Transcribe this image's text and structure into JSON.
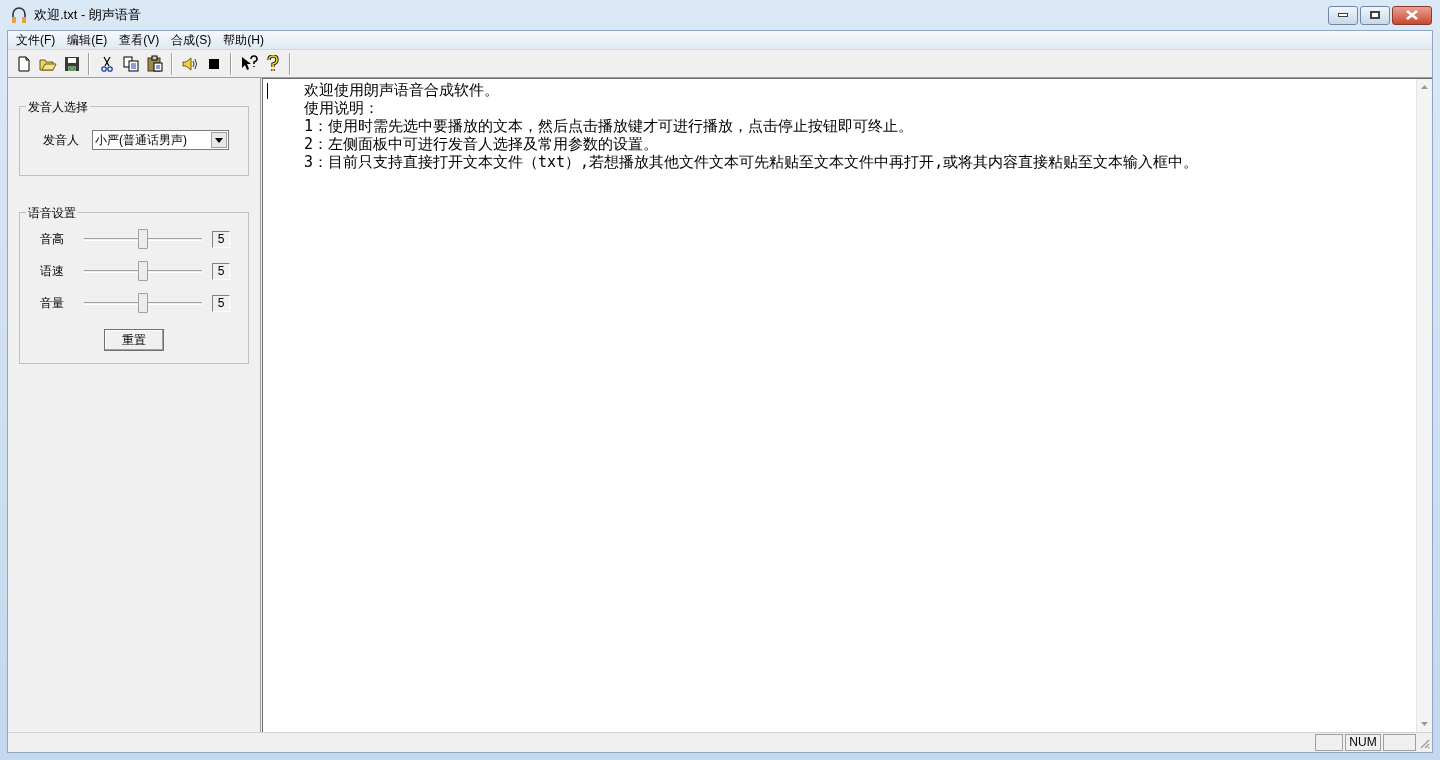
{
  "window": {
    "title": "欢迎.txt - 朗声语音"
  },
  "menu": [
    "文件(F)",
    "编辑(E)",
    "查看(V)",
    "合成(S)",
    "帮助(H)"
  ],
  "speaker_group": {
    "title": "发音人选择",
    "label": "发音人",
    "value": "小严(普通话男声)"
  },
  "voice_group": {
    "title": "语音设置",
    "sliders": [
      {
        "label": "音高",
        "level": 0.5,
        "value": "5"
      },
      {
        "label": "语速",
        "level": 0.5,
        "value": "5"
      },
      {
        "label": "音量",
        "level": 0.5,
        "value": "5"
      }
    ],
    "button": "重置"
  },
  "editor": {
    "lines": [
      "欢迎使用朗声语音合成软件。",
      "使用说明：",
      "1：使用时需先选中要播放的文本，然后点击播放键才可进行播放，点击停止按钮即可终止。",
      "2：左侧面板中可进行发音人选择及常用参数的设置。",
      "3：目前只支持直接打开文本文件（txt）,若想播放其他文件文本可先粘贴至文本文件中再打开,或将其内容直接粘贴至文本输入框中。"
    ]
  },
  "status_bar": {
    "indicator": "NUM"
  }
}
